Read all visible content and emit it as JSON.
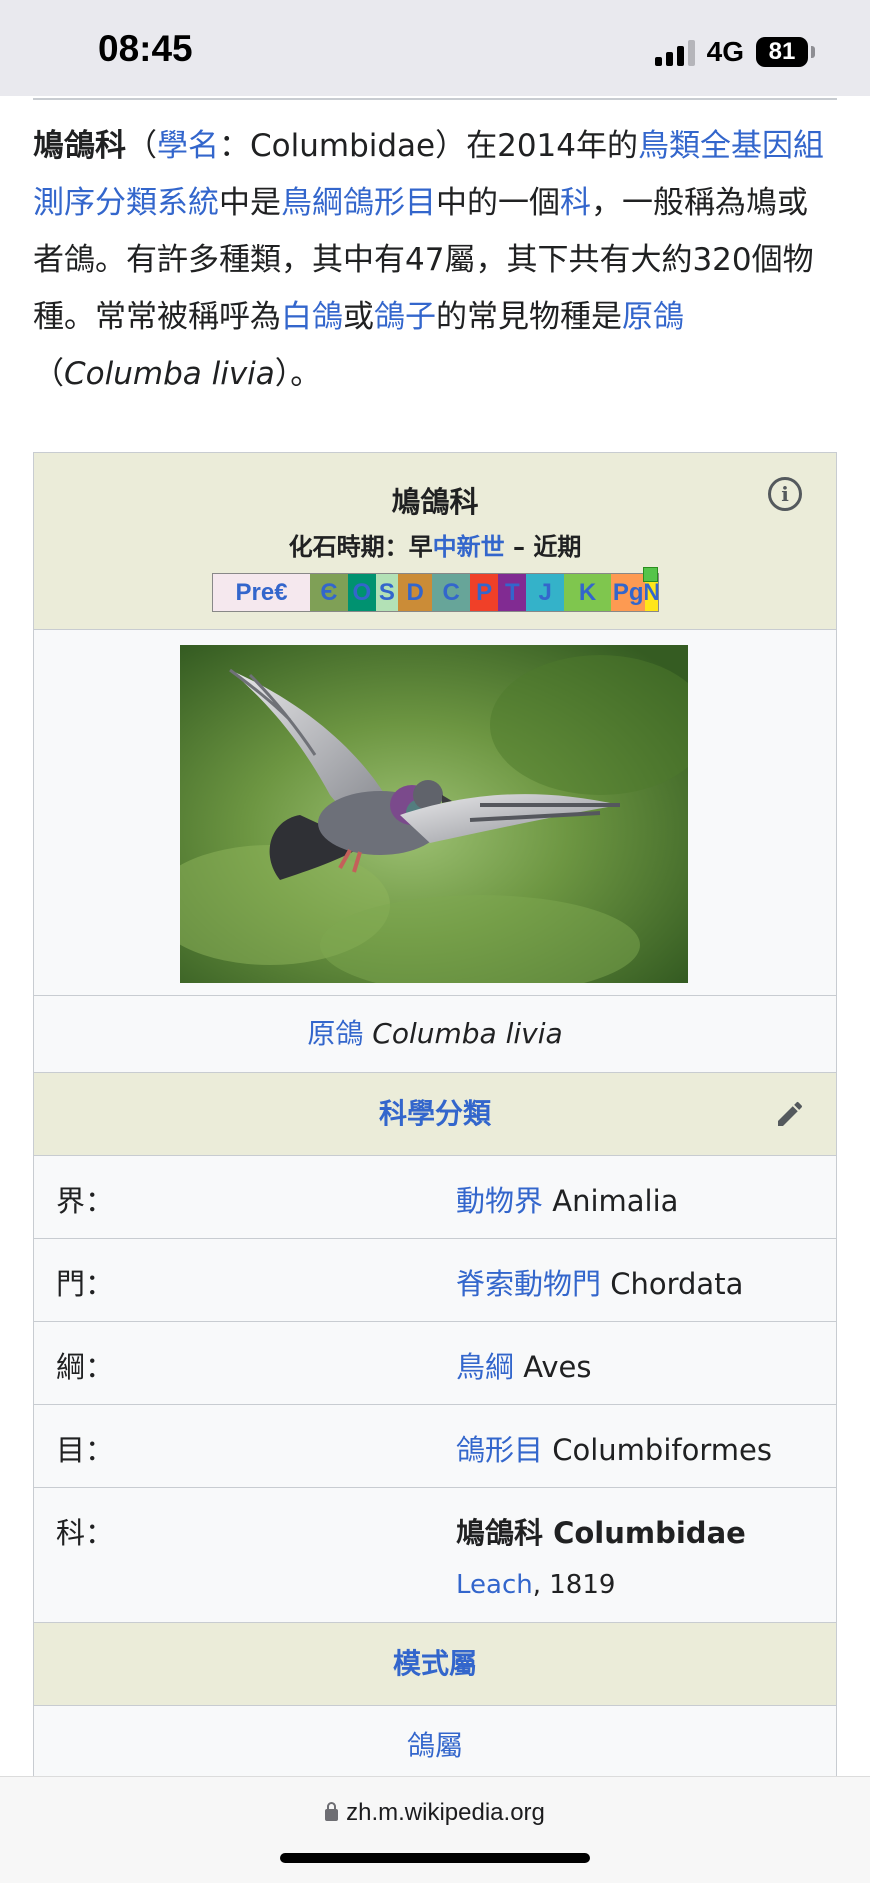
{
  "status": {
    "time": "08:45",
    "network": "4G",
    "battery": "81"
  },
  "intro": {
    "title": "鳩鴿科",
    "t1": "（",
    "l1": "學名",
    "t2": "：Columbidae）在2014年的",
    "l2": "鳥類全基因組測序分類系統",
    "t3": "中是",
    "l3": "鳥綱",
    "l4": "鴿形目",
    "t4": "中的一個",
    "l5": "科",
    "t5": "，一般稱為鳩或者鴿。有許多種類，其中有47屬，其下共有大約320個物種。常常被稱呼為",
    "l6": "白鴿",
    "t6": "或",
    "l7": "鴿子",
    "t7": "的常見物種是",
    "l8": "原鴿",
    "t8": "（",
    "sci": "Columba livia",
    "t9": "）。"
  },
  "infobox": {
    "title": "鳩鴿科",
    "fossil_prefix": "化石時期：早",
    "fossil_link": "中新世",
    "fossil_suffix": " – 近期",
    "timescale": [
      {
        "label": "Pre€",
        "color": "#f5e8ee",
        "flex": 1.55
      },
      {
        "label": "Є",
        "color": "#7fa056",
        "flex": 0.6
      },
      {
        "label": "O",
        "color": "#009270",
        "flex": 0.45
      },
      {
        "label": "S",
        "color": "#b3e1b6",
        "flex": 0.35
      },
      {
        "label": "D",
        "color": "#cb8c37",
        "flex": 0.55
      },
      {
        "label": "C",
        "color": "#67a599",
        "flex": 0.6
      },
      {
        "label": "P",
        "color": "#f04028",
        "flex": 0.45
      },
      {
        "label": "T",
        "color": "#812b92",
        "flex": 0.45
      },
      {
        "label": "J",
        "color": "#34b2c9",
        "flex": 0.6
      },
      {
        "label": "K",
        "color": "#7fc64e",
        "flex": 0.75
      },
      {
        "label": "Pg",
        "color": "#fd9a52",
        "flex": 0.55
      },
      {
        "label": "N",
        "color": "#ffe619",
        "flex": 0.2
      }
    ],
    "caption_link": "原鴿",
    "caption_sci": "Columba livia",
    "classification_heading": "科學分類",
    "rows": [
      {
        "label": "界：",
        "link": "動物界",
        "latin": "Animalia"
      },
      {
        "label": "門：",
        "link": "脊索動物門",
        "latin": "Chordata"
      },
      {
        "label": "綱：",
        "link": "鳥綱",
        "latin": "Aves"
      },
      {
        "label": "目：",
        "link": "鴿形目",
        "latin": "Columbiformes"
      }
    ],
    "family": {
      "label": "科：",
      "name": "鳩鴿科 Columbidae",
      "author": "Leach",
      "year": ", 1819"
    },
    "type_genus_heading": "模式屬",
    "type_genus": "鴿屬"
  },
  "browser": {
    "url": "zh.m.wikipedia.org"
  }
}
